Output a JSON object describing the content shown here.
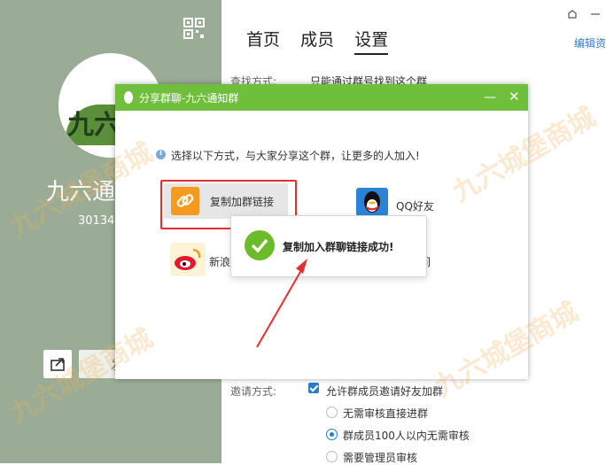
{
  "profile": {
    "group_name": "九六通",
    "group_number": "30134",
    "avatar_text": "九六",
    "half_button_char": "发"
  },
  "top": {
    "tabs": [
      "首页",
      "成员",
      "设置"
    ],
    "active_tab": "设置",
    "edit_link": "编辑资"
  },
  "settings": {
    "find_label": "查找方式:",
    "find_value": "只能通过群号找到这个群",
    "invite_label": "邀请方式:",
    "invite_checkbox": "允许群成员邀请好友加群",
    "radio_options": [
      "无需审核直接进群",
      "群成员100人以内无需审核",
      "需要管理员审核"
    ],
    "radio_selected": "群成员100人以内无需审核"
  },
  "dialog": {
    "title": "分享群聊-九六通知群",
    "minimize": "—",
    "close": "✕",
    "info": "选择以下方式，与大家分享这个群，让更多的人加入!",
    "copy_button": "复制加群链接",
    "qq_label": "QQ好友",
    "weibo_label": "新浪",
    "hidden_tail": "间",
    "toast": "复制加入群聊链接成功!"
  },
  "watermark": "九六城堡商城",
  "colors": {
    "title_bar": "#6fbf3c",
    "left_panel": "#9aac95",
    "accent": "#2e7ccc",
    "highlight_box": "#e3302f",
    "success": "#6cbb2a"
  }
}
